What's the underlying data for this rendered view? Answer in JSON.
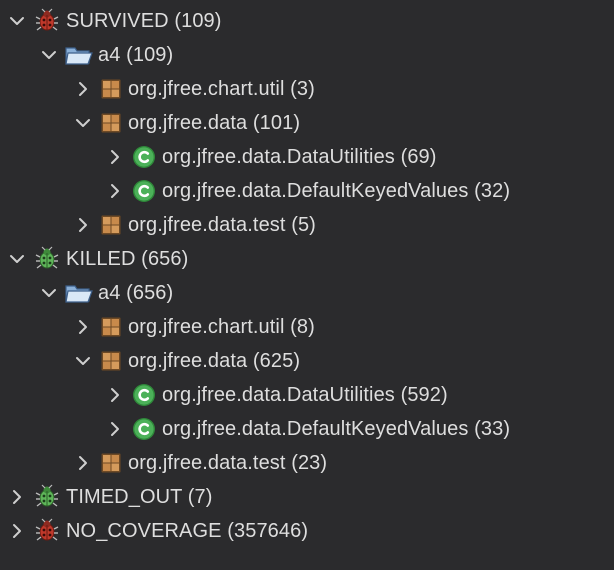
{
  "tree": {
    "survived": {
      "label": "SURVIVED (109)",
      "a4": {
        "label": "a4 (109)",
        "pkg_chart_util": "org.jfree.chart.util (3)",
        "pkg_data": {
          "label": "org.jfree.data (101)",
          "class_datautilities": "org.jfree.data.DataUtilities (69)",
          "class_defaultkeyedvalues": "org.jfree.data.DefaultKeyedValues (32)"
        },
        "pkg_data_test": "org.jfree.data.test (5)"
      }
    },
    "killed": {
      "label": "KILLED (656)",
      "a4": {
        "label": "a4 (656)",
        "pkg_chart_util": "org.jfree.chart.util (8)",
        "pkg_data": {
          "label": "org.jfree.data (625)",
          "class_datautilities": "org.jfree.data.DataUtilities (592)",
          "class_defaultkeyedvalues": "org.jfree.data.DefaultKeyedValues (33)"
        },
        "pkg_data_test": "org.jfree.data.test (23)"
      }
    },
    "timed_out": {
      "label": "TIMED_OUT (7)"
    },
    "no_coverage": {
      "label": "NO_COVERAGE (357646)"
    }
  },
  "colors": {
    "background": "#2b2b2d",
    "text": "#dedede",
    "chevron": "#cfcfcf",
    "class_icon_green": "#3fa34a",
    "package_icon_brown": "#b9804a",
    "folder_blue": "#7fa7d6",
    "bug_red": "#c0392b",
    "bug_green": "#4caf50"
  },
  "icons": {
    "expanded": "chevron-down-icon",
    "collapsed": "chevron-right-icon",
    "folder": "open-folder-icon",
    "package": "package-icon",
    "class": "class-icon",
    "status_survived": "red-bug-icon",
    "status_killed": "green-bug-icon"
  }
}
